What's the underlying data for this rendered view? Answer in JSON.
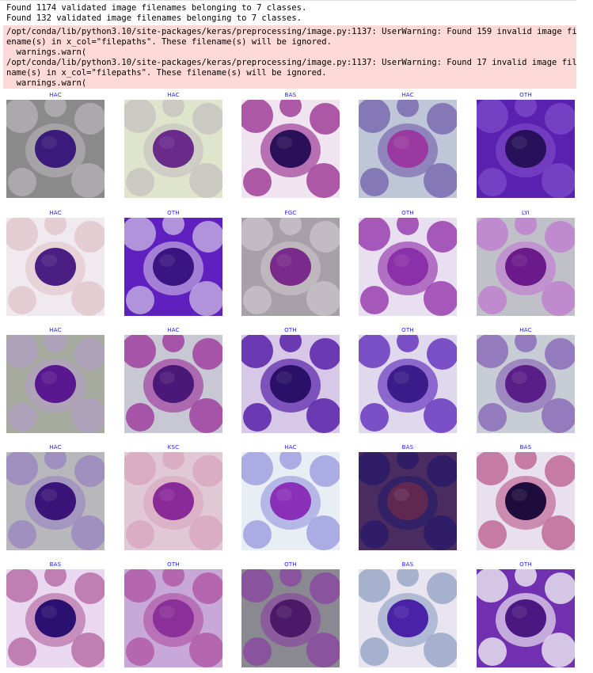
{
  "stdout": {
    "lines": [
      "Found 1174 validated image filenames belonging to 7 classes.",
      "Found 132 validated image filenames belonging to 7 classes."
    ]
  },
  "stderr": {
    "lines": [
      "/opt/conda/lib/python3.10/site-packages/keras/preprocessing/image.py:1137: UserWarning: Found 159 invalid image fil",
      "ename(s) in x_col=\"filepaths\". These filename(s) will be ignored.",
      "  warnings.warn(",
      "/opt/conda/lib/python3.10/site-packages/keras/preprocessing/image.py:1137: UserWarning: Found 17 invalid image file",
      "name(s) in x_col=\"filepaths\". These filename(s) will be ignored.",
      "  warnings.warn("
    ]
  },
  "colors": {
    "label": "#1a1aff",
    "stderr_bg": "#fdd9d7"
  },
  "images": [
    {
      "label": "HAC",
      "bg": "#8a8a8a",
      "cell": "#3a1a7a",
      "fill": "#b0aeb0"
    },
    {
      "label": "HAC",
      "bg": "#dfe5cc",
      "cell": "#6a2a8a",
      "fill": "#c8c4c0"
    },
    {
      "label": "BAS",
      "bg": "#efe4ef",
      "cell": "#2a1058",
      "fill": "#a0409a"
    },
    {
      "label": "HAC",
      "bg": "#bfc6d8",
      "cell": "#9a3aa0",
      "fill": "#7a6ab0"
    },
    {
      "label": "OTH",
      "bg": "#5a20b0",
      "cell": "#28105a",
      "fill": "#7a48c8"
    },
    {
      "label": "HAC",
      "bg": "#f0eaf0",
      "cell": "#4a1e82",
      "fill": "#e2c8cc"
    },
    {
      "label": "OTH",
      "bg": "#6020c0",
      "cell": "#3a1480",
      "fill": "#c0a8e0"
    },
    {
      "label": "FGC",
      "bg": "#a8a0a8",
      "cell": "#7a2a8a",
      "fill": "#c8c0c8"
    },
    {
      "label": "OTH",
      "bg": "#e8e0f0",
      "cell": "#8a30a8",
      "fill": "#9a40b0"
    },
    {
      "label": "LYI",
      "bg": "#c0c0c8",
      "cell": "#6a1a8a",
      "fill": "#c080d0"
    },
    {
      "label": "HAC",
      "bg": "#a8aca0",
      "cell": "#5a1890",
      "fill": "#b0a0c0"
    },
    {
      "label": "HAC",
      "bg": "#c8c8d4",
      "cell": "#4a1878",
      "fill": "#a040a0"
    },
    {
      "label": "OTH",
      "bg": "#d8c8e8",
      "cell": "#2a1068",
      "fill": "#5820a8"
    },
    {
      "label": "OTH",
      "bg": "#e0d8ec",
      "cell": "#3a1c8a",
      "fill": "#6838c0"
    },
    {
      "label": "HAC",
      "bg": "#c8ccd4",
      "cell": "#5a1e88",
      "fill": "#8a6cb8"
    },
    {
      "label": "HAC",
      "bg": "#b8b8bc",
      "cell": "#3a1478",
      "fill": "#9a88c0"
    },
    {
      "label": "KSC",
      "bg": "#e0c8d4",
      "cell": "#8a2a98",
      "fill": "#d8a8c0"
    },
    {
      "label": "HAC",
      "bg": "#e8eef4",
      "cell": "#8a30b8",
      "fill": "#a0a0e0"
    },
    {
      "label": "BAS",
      "bg": "#4a2c60",
      "cell": "#602850",
      "fill": "#2a1c68"
    },
    {
      "label": "BAS",
      "bg": "#e8e0ec",
      "cell": "#1e0c3c",
      "fill": "#c06898"
    },
    {
      "label": "BAS",
      "bg": "#ead8f0",
      "cell": "#2a1070",
      "fill": "#b870a8"
    },
    {
      "label": "OTH",
      "bg": "#c8a8d8",
      "cell": "#8a3098",
      "fill": "#b05aa8"
    },
    {
      "label": "OTH",
      "bg": "#8a8890",
      "cell": "#4a1a68",
      "fill": "#8a4aa0"
    },
    {
      "label": "BAS",
      "bg": "#e8e4f0",
      "cell": "#4a22a8",
      "fill": "#9aa8c8"
    },
    {
      "label": "OTH",
      "bg": "#7030b0",
      "cell": "#4a1880",
      "fill": "#e8e0f0"
    }
  ]
}
